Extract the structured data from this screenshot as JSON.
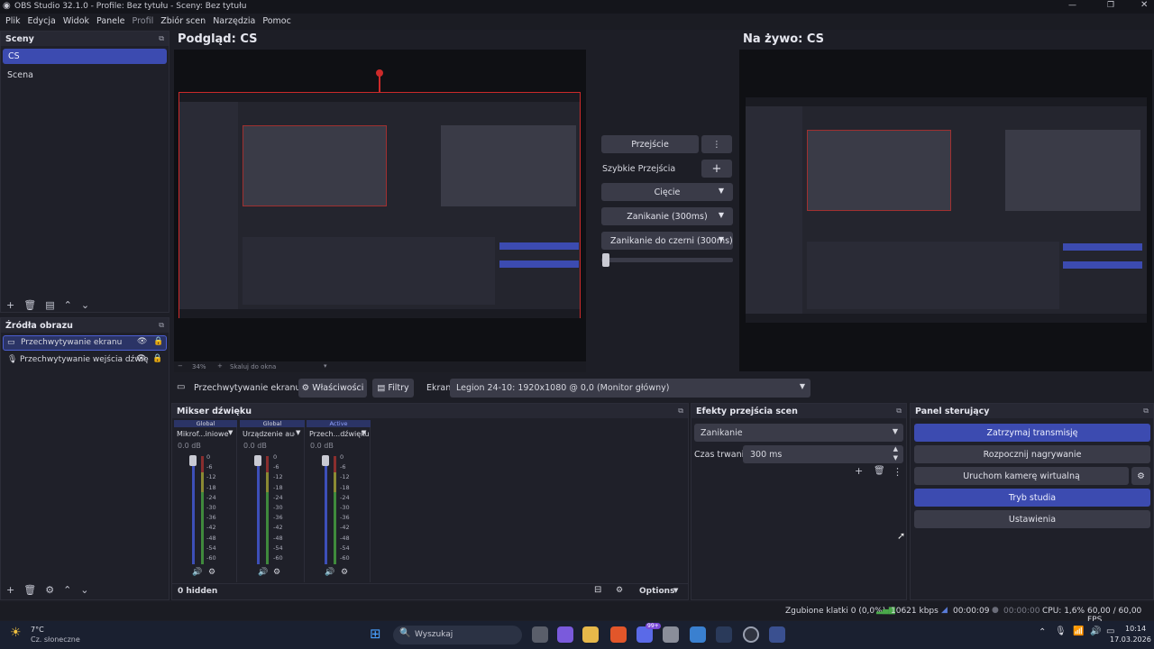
{
  "window": {
    "title": "OBS Studio 32.1.0 - Profile: Bez tytułu - Sceny: Bez tytułu"
  },
  "menu": [
    "Plik",
    "Edycja",
    "Widok",
    "Panele",
    "Profil",
    "Zbiór scen",
    "Narzędzia",
    "Pomoc"
  ],
  "scenes": {
    "title": "Sceny",
    "items": [
      "CS",
      "Scena"
    ]
  },
  "sources": {
    "title": "Źródła obrazu",
    "items": [
      "Przechwytywanie ekranu",
      "Przechwytywanie wejścia dźwię"
    ]
  },
  "preview": {
    "label": "Podgląd: CS",
    "zoom": "34%",
    "scale": "Skaluj do okna"
  },
  "live": {
    "label": "Na żywo: CS"
  },
  "transitions": {
    "transition_btn": "Przejście",
    "quick": "Szybkie Przejścia",
    "items": [
      "Cięcie",
      "Zanikanie (300ms)",
      "Zanikanie do czerni (300ms)"
    ]
  },
  "sourcebar": {
    "name": "Przechwytywanie ekranu",
    "props": "Właściwości",
    "filters": "Filtry",
    "screen_label": "Ekran",
    "screen_value": "Legion 24-10: 1920x1080 @ 0,0 (Monitor główny)"
  },
  "mixer": {
    "title": "Mikser dźwięku",
    "channels": [
      {
        "mode": "Global",
        "name": "Mikrof...iniowe",
        "db": "0.0 dB"
      },
      {
        "mode": "Global",
        "name": "Urządzenie audio",
        "db": "0.0 dB"
      },
      {
        "mode": "Active",
        "name": "Przech...dźwięku",
        "db": "0.0 dB"
      }
    ],
    "ticks": [
      "0",
      "-6",
      "-12",
      "-18",
      "-24",
      "-30",
      "-36",
      "-42",
      "-48",
      "-54",
      "-60"
    ],
    "hidden": "0 hidden",
    "options": "Options"
  },
  "scene_transitions": {
    "title": "Efekty przejścia scen",
    "type": "Zanikanie",
    "duration_label": "Czas trwania",
    "duration": "300 ms"
  },
  "controls": {
    "title": "Panel sterujący",
    "buttons": [
      "Zatrzymaj transmisję",
      "Rozpocznij nagrywanie",
      "Uruchom kamerę wirtualną",
      "Tryb studia",
      "Ustawienia"
    ]
  },
  "status": {
    "dropped": "Zgubione klatki 0 (0,0%)",
    "kbps": "10621 kbps",
    "stream_time": "00:00:09",
    "rec_time": "00:00:00",
    "cpu": "CPU: 1,6%",
    "fps": "60,00 / 60,00 FPS"
  },
  "taskbar": {
    "temp": "7°C",
    "weather": "Cz. słoneczne",
    "search": "Wyszukaj",
    "time": "10:14",
    "date": "17.03.2026",
    "badge": "99+"
  },
  "colors": {
    "accent": "#3c4bb0",
    "red": "#cc2a2a"
  }
}
